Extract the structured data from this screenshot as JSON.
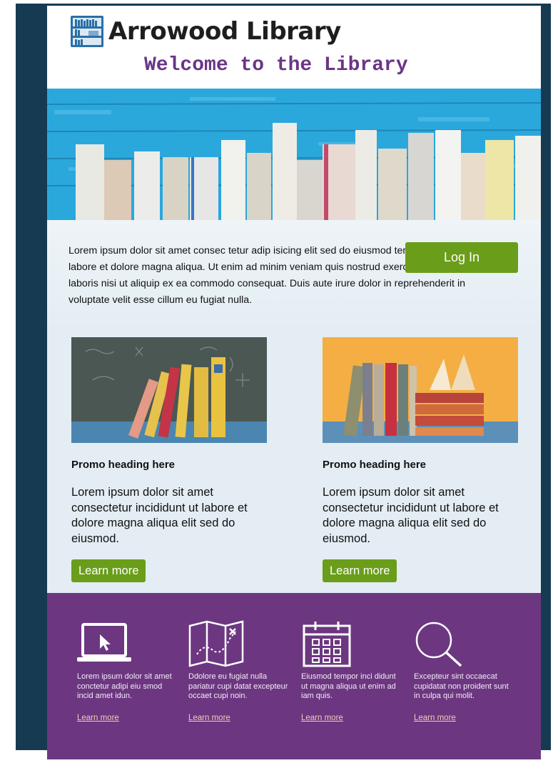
{
  "header": {
    "brand_icon": "bookshelf-icon",
    "library_name": "Arrowood Library",
    "welcome": "Welcome to the Library"
  },
  "intro": {
    "text": "Lorem ipsum dolor sit amet consec tetur adip isicing elit sed do eiusmod tempor incididunt ut labore et dolore magna aliqua. Ut enim ad minim veniam quis nostrud exercita tion ullamco laboris nisi ut aliquip ex ea commodo consequat. Duis aute irure dolor in reprehenderit in voluptate velit esse cillum eu fugiat nulla.",
    "login_label": "Log In"
  },
  "promos": [
    {
      "heading": "Promo heading here",
      "text": "Lorem ipsum dolor sit amet consectetur incididunt ut labore et dolore magna aliqua elit sed do eiusmod.",
      "button": "Learn more"
    },
    {
      "heading": "Promo heading here",
      "text": "Lorem ipsum dolor sit amet consectetur incididunt ut labore et dolore magna aliqua elit sed do eiusmod.",
      "button": "Learn more"
    }
  ],
  "features": [
    {
      "icon": "laptop-cursor-icon",
      "text": "Lorem ipsum dolor sit amet conctetur adipi eiu smod incid amet idun.",
      "link": "Learn more"
    },
    {
      "icon": "map-icon",
      "text": "Ddolore eu fugiat nulla pariatur cupi datat excepteur occaet cupi noin.",
      "link": "Learn more"
    },
    {
      "icon": "calendar-icon",
      "text": "Eiusmod tempor inci didunt ut magna aliqua ut enim ad iam quis.",
      "link": "Learn more"
    },
    {
      "icon": "search-icon",
      "text": "Excepteur sint occaecat cupidatat non proident sunt in culpa qui molit.",
      "link": "Learn more"
    }
  ],
  "colors": {
    "frame": "#163a52",
    "purple": "#6c3780",
    "green": "#6a9d1a",
    "link": "#f7c9b4"
  }
}
